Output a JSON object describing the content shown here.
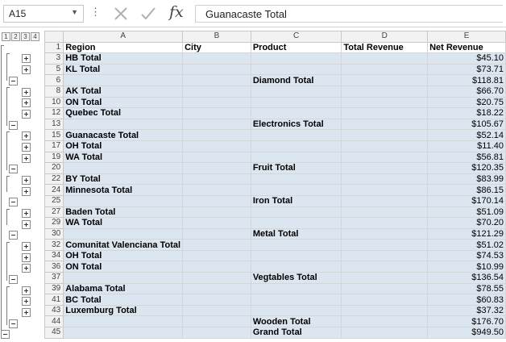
{
  "formula_bar": {
    "name_box": "A15",
    "name_box_arrow": "▼",
    "menu_dots": "⋮",
    "fx_label": "fx",
    "formula": "Guanacaste Total"
  },
  "outline_levels": [
    "1",
    "2",
    "3",
    "4"
  ],
  "columns": [
    "A",
    "B",
    "C",
    "D",
    "E"
  ],
  "header_row": {
    "row": "1",
    "cells": [
      "Region",
      "City",
      "Product",
      "Total Revenue",
      "Net Revenue"
    ]
  },
  "rows": [
    {
      "row": "3",
      "region": "HB Total",
      "product": "",
      "net": "$45.10"
    },
    {
      "row": "5",
      "region": "KL Total",
      "product": "",
      "net": "$73.71"
    },
    {
      "row": "6",
      "region": "",
      "product": "Diamond Total",
      "net": "$118.81"
    },
    {
      "row": "8",
      "region": "AK Total",
      "product": "",
      "net": "$66.70"
    },
    {
      "row": "10",
      "region": "ON Total",
      "product": "",
      "net": "$20.75"
    },
    {
      "row": "12",
      "region": "Quebec Total",
      "product": "",
      "net": "$18.22"
    },
    {
      "row": "13",
      "region": "",
      "product": "Electronics Total",
      "net": "$105.67"
    },
    {
      "row": "15",
      "region": "Guanacaste Total",
      "product": "",
      "net": "$52.14"
    },
    {
      "row": "17",
      "region": "OH Total",
      "product": "",
      "net": "$11.40"
    },
    {
      "row": "19",
      "region": "WA Total",
      "product": "",
      "net": "$56.81"
    },
    {
      "row": "20",
      "region": "",
      "product": "Fruit Total",
      "net": "$120.35"
    },
    {
      "row": "22",
      "region": "BY Total",
      "product": "",
      "net": "$83.99"
    },
    {
      "row": "24",
      "region": "Minnesota Total",
      "product": "",
      "net": "$86.15"
    },
    {
      "row": "25",
      "region": "",
      "product": "Iron Total",
      "net": "$170.14"
    },
    {
      "row": "27",
      "region": "Baden Total",
      "product": "",
      "net": "$51.09"
    },
    {
      "row": "29",
      "region": "WA Total",
      "product": "",
      "net": "$70.20"
    },
    {
      "row": "30",
      "region": "",
      "product": "Metal Total",
      "net": "$121.29"
    },
    {
      "row": "32",
      "region": "Comunitat Valenciana Total",
      "product": "",
      "net": "$51.02"
    },
    {
      "row": "34",
      "region": "OH Total",
      "product": "",
      "net": "$74.53"
    },
    {
      "row": "36",
      "region": "ON Total",
      "product": "",
      "net": "$10.99"
    },
    {
      "row": "37",
      "region": "",
      "product": "Vegtables Total",
      "net": "$136.54"
    },
    {
      "row": "39",
      "region": "Alabama Total",
      "product": "",
      "net": "$78.55"
    },
    {
      "row": "41",
      "region": "BC Total",
      "product": "",
      "net": "$60.83"
    },
    {
      "row": "43",
      "region": "Luxemburg Total",
      "product": "",
      "net": "$37.32"
    },
    {
      "row": "44",
      "region": "",
      "product": "Wooden Total",
      "net": "$176.70"
    },
    {
      "row": "45",
      "region": "",
      "product": "Grand Total",
      "net": "$949.50"
    }
  ]
}
